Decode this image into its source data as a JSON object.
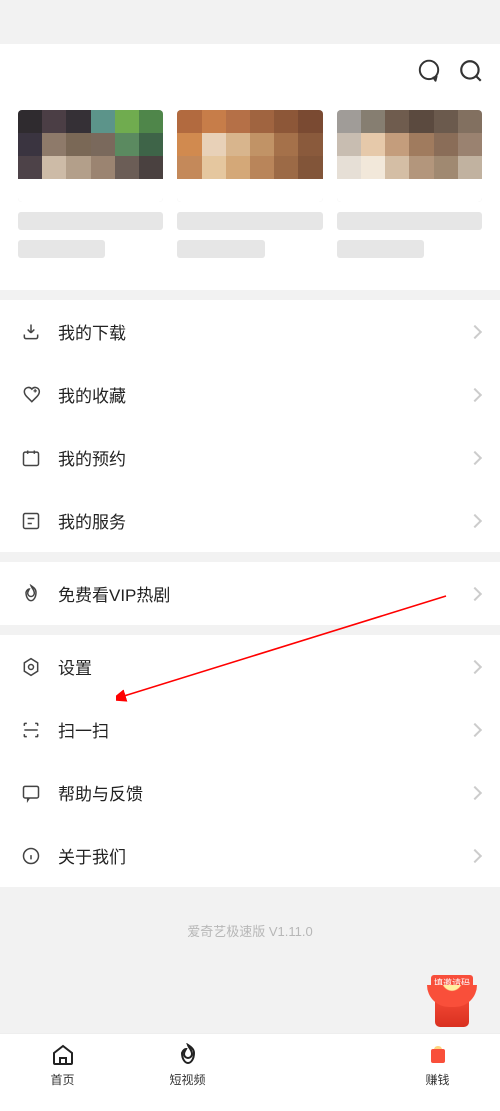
{
  "menu": {
    "downloads": "我的下载",
    "favorites": "我的收藏",
    "reservations": "我的预约",
    "services": "我的服务",
    "freeVip": "免费看VIP热剧",
    "settings": "设置",
    "scan": "扫一扫",
    "help": "帮助与反馈",
    "about": "关于我们"
  },
  "version": "爱奇艺极速版 V1.11.0",
  "nav": {
    "home": "首页",
    "shortVideo": "短视频",
    "earn": "赚钱"
  },
  "badge": "填邀请码"
}
